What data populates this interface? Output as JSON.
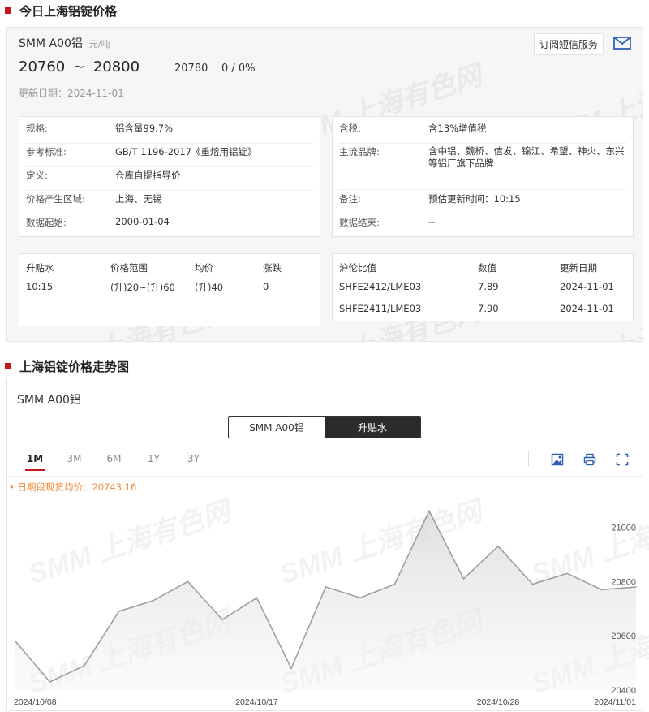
{
  "section1": {
    "title": "今日上海铝锭价格"
  },
  "product": {
    "name": "SMM A00铝",
    "unit": "元/吨",
    "range_low": "20760",
    "range_sep": "~",
    "range_high": "20800",
    "avg": "20780",
    "change": "0  /  0%",
    "update": "更新日期：2024-11-01"
  },
  "subscribe": {
    "label": "订阅短信服务"
  },
  "specs_left": [
    {
      "k": "规格:",
      "v": "铝含量99.7%"
    },
    {
      "k": "参考标准:",
      "v": "GB/T 1196-2017《重熔用铝锭》"
    },
    {
      "k": "定义:",
      "v": "仓库自提指导价"
    },
    {
      "k": "价格产生区域:",
      "v": "上海、无锡"
    },
    {
      "k": "数据起始:",
      "v": "2000-01-04"
    }
  ],
  "specs_right": [
    {
      "k": "含税:",
      "v": "含13%增值税"
    },
    {
      "k": "主流品牌:",
      "v": "含中铝、魏桥、信发、锦江、希望、神火、东兴等铝厂旗下品牌"
    },
    {
      "k": "备注:",
      "v": "预估更新时间：10:15"
    },
    {
      "k": "数据结束:",
      "v": "--"
    }
  ],
  "premium": {
    "headers": [
      "升贴水",
      "价格范围",
      "均价",
      "涨跌"
    ],
    "row": [
      "10:15",
      "(升)20~(升)60",
      "(升)40",
      "0"
    ]
  },
  "ratio": {
    "headers": [
      "沪伦比值",
      "数值",
      "更新日期"
    ],
    "rows": [
      [
        "SHFE2412/LME03",
        "7.89",
        "2024-11-01"
      ],
      [
        "SHFE2411/LME03",
        "7.90",
        "2024-11-01"
      ]
    ]
  },
  "section2": {
    "title": "上海铝锭价格走势图"
  },
  "chart_panel": {
    "product": "SMM A00铝",
    "toggle": [
      "SMM A00铝",
      "升贴水"
    ],
    "ranges": [
      "1M",
      "3M",
      "6M",
      "1Y",
      "3Y"
    ],
    "avg_note": "• 日期段现货均价：20743.16"
  },
  "watermark": "SMM 上海有色网",
  "colors": {
    "accent": "#c8161d",
    "line": "#9a9a9a",
    "avg_note": "#f08c3c"
  },
  "chart_data": {
    "type": "area",
    "x": [
      "2024/10/08",
      "2024/10/09",
      "2024/10/10",
      "2024/10/11",
      "2024/10/14",
      "2024/10/15",
      "2024/10/16",
      "2024/10/17",
      "2024/10/18",
      "2024/10/21",
      "2024/10/22",
      "2024/10/23",
      "2024/10/24",
      "2024/10/25",
      "2024/10/28",
      "2024/10/29",
      "2024/10/30",
      "2024/10/31",
      "2024/11/01"
    ],
    "values": [
      20580,
      20430,
      20490,
      20690,
      20730,
      20800,
      20660,
      20740,
      20480,
      20780,
      20740,
      20790,
      21060,
      20810,
      20930,
      20790,
      20830,
      20770,
      20780
    ],
    "x_tick_labels": [
      "2024/10/08",
      "2024/10/17",
      "2024/10/28",
      "2024/11/01"
    ],
    "y_tick_labels": [
      "20400",
      "20600",
      "20800",
      "21000"
    ],
    "ylim": [
      20400,
      21100
    ],
    "grid": false
  }
}
